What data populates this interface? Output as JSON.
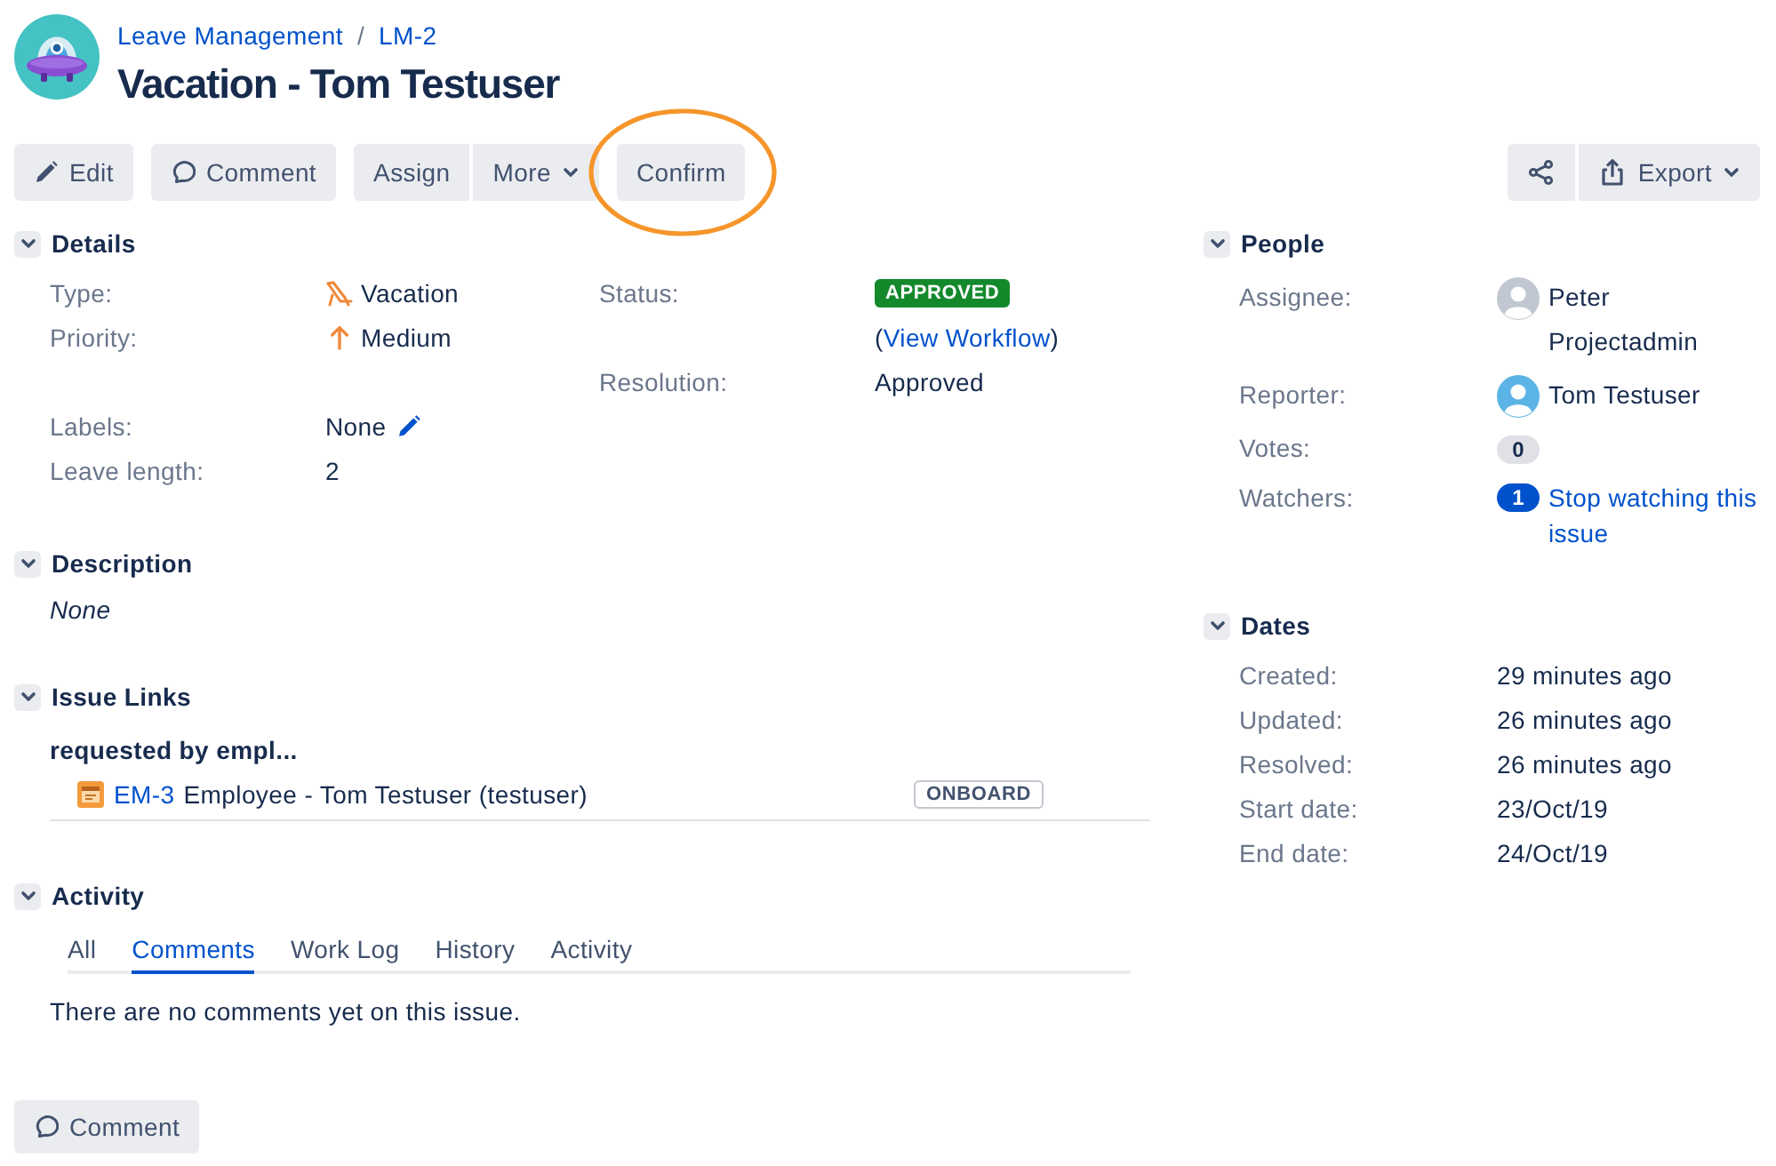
{
  "header": {
    "breadcrumbs": [
      {
        "label": "Leave Management"
      },
      {
        "label": "LM-2"
      }
    ],
    "separator": "/",
    "title": "Vacation - Tom Testuser"
  },
  "toolbar": {
    "left": [
      {
        "buttons": [
          {
            "kind": "edit",
            "label": "Edit",
            "highlighted": false
          }
        ]
      },
      {
        "buttons": [
          {
            "kind": "comment",
            "label": "Comment",
            "highlighted": false
          }
        ]
      },
      {
        "buttons": [
          {
            "kind": "text",
            "label": "Assign",
            "highlighted": false
          },
          {
            "kind": "menu",
            "label": "More",
            "highlighted": false
          }
        ]
      },
      {
        "buttons": [
          {
            "kind": "text",
            "label": "Confirm",
            "highlighted": true
          }
        ]
      }
    ],
    "right": [
      {
        "buttons": [
          {
            "kind": "share",
            "highlighted": false
          },
          {
            "kind": "export",
            "label": "Export",
            "highlighted": false
          }
        ]
      }
    ]
  },
  "details": {
    "title": "Details",
    "expanded": true,
    "left": [
      {
        "label": "Type:",
        "kind": "issue-type",
        "value": "Vacation"
      },
      {
        "label": "Priority:",
        "kind": "priority",
        "value": "Medium"
      }
    ],
    "right": [
      {
        "label": "Status:",
        "kind": "status",
        "value": "APPROVED",
        "workflow_prefix": "(",
        "workflow_link": "View Workflow",
        "workflow_suffix": ")"
      },
      {
        "label": "Resolution:",
        "kind": "text",
        "value": "Approved"
      }
    ],
    "bottom": [
      {
        "label": "Labels:",
        "kind": "labels",
        "value": "None"
      },
      {
        "label": "Leave length:",
        "kind": "text",
        "value": "2"
      }
    ]
  },
  "description": {
    "title": "Description",
    "expanded": true,
    "text": "None"
  },
  "issue_links": {
    "title": "Issue Links",
    "expanded": true,
    "groups": [
      {
        "relation": "requested by empl...",
        "links": [
          {
            "key": "EM-3",
            "summary": "Employee - Tom Testuser (testuser)",
            "status": "ONBOARD"
          }
        ]
      }
    ]
  },
  "activity": {
    "title": "Activity",
    "expanded": true,
    "tabs": [
      {
        "label": "All",
        "selected": false
      },
      {
        "label": "Comments",
        "selected": true
      },
      {
        "label": "Work Log",
        "selected": false
      },
      {
        "label": "History",
        "selected": false
      },
      {
        "label": "Activity",
        "selected": false
      }
    ],
    "empty_text": "There are no comments yet on this issue."
  },
  "comment_button": {
    "label": "Comment"
  },
  "people": {
    "title": "People",
    "expanded": true,
    "fields": [
      {
        "label": "Assignee:",
        "kind": "user",
        "value": "Peter Projectadmin",
        "color": "#c1c7d0"
      },
      {
        "label": "Reporter:",
        "kind": "user",
        "value": "Tom Testuser",
        "color": "#5bb4e5"
      },
      {
        "label": "Votes:",
        "kind": "count",
        "value": "0"
      },
      {
        "label": "Watchers:",
        "kind": "watch",
        "value": "1",
        "link": "Stop watching this issue"
      }
    ]
  },
  "dates": {
    "title": "Dates",
    "expanded": true,
    "fields": [
      {
        "label": "Created:",
        "value": "29 minutes ago"
      },
      {
        "label": "Updated:",
        "value": "26 minutes ago"
      },
      {
        "label": "Resolved:",
        "value": "26 minutes ago"
      },
      {
        "label": "Start date:",
        "value": "23/Oct/19"
      },
      {
        "label": "End date:",
        "value": "24/Oct/19"
      }
    ]
  }
}
